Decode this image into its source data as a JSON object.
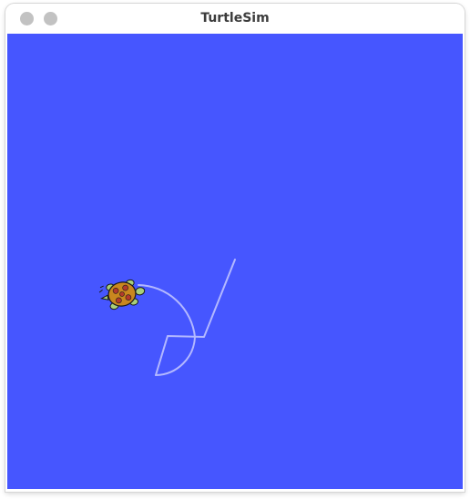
{
  "window": {
    "title": "TurtleSim",
    "buttons": [
      {
        "name": "close"
      },
      {
        "name": "minimize"
      }
    ]
  },
  "canvas": {
    "background_color": "#4656ff",
    "pen_color": "#b3b8ff",
    "turtle": {
      "shell_color": "#c9871f",
      "shell_pattern_color": "#b23a2c",
      "body_color": "#a8cf7a",
      "outline_color": "#1a1a1a"
    }
  }
}
